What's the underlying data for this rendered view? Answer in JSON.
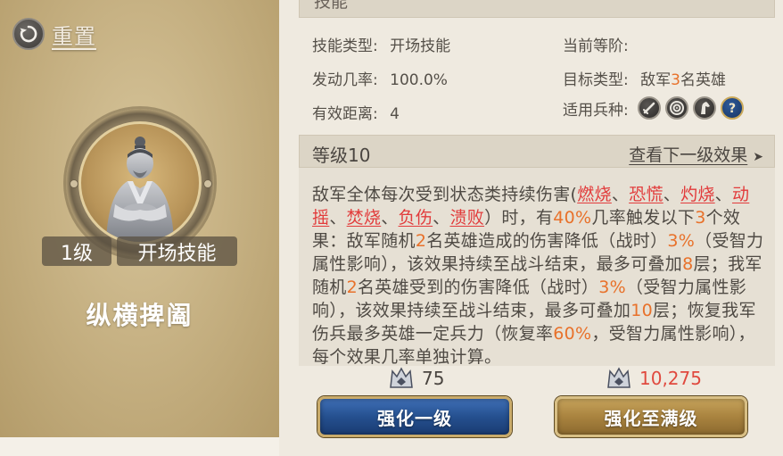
{
  "left": {
    "reset_label": "重置",
    "level_badge": "1级",
    "type_badge": "开场技能",
    "skill_name": "纵横捭阖"
  },
  "right": {
    "header_title": "技能",
    "info": {
      "skill_type_label": "技能类型:",
      "skill_type_value": "开场技能",
      "rank_label": "当前等阶:",
      "rank_value": "",
      "trigger_rate_label": "发动几率:",
      "trigger_rate_value": "100.0%",
      "target_type_label": "目标类型:",
      "target_type_prefix": "敌军",
      "target_type_count": "3",
      "target_type_suffix": "名英雄",
      "range_label": "有效距离:",
      "range_value": "4",
      "unit_types_label": "适用兵种:",
      "unit_icons": [
        "sword-icon",
        "target-icon",
        "horse-icon",
        "question-icon"
      ]
    },
    "level_bar": {
      "title": "等级10",
      "next_link": "查看下一级效果",
      "next_arrow": "➤"
    },
    "description": {
      "p1": "敌军全体每次受到状态类持续伤害(",
      "s1": "燃烧",
      "sep1": "、",
      "s2": "恐慌",
      "sep2": "、",
      "s3": "灼烧",
      "sep3": "、",
      "s4": "动摇",
      "sep4": "、",
      "s5": "焚烧",
      "sep5": "、",
      "s6": "负伤",
      "sep6": "、",
      "s7": "溃败",
      "p2": "）时，有",
      "n1": "40%",
      "p3": "几率触发以下",
      "n2": "3",
      "p4": "个效果：敌军随机",
      "n3": "2",
      "p5": "名英雄造成的伤害降低（战时）",
      "n4": "3%",
      "p6": "（受智力属性影响），该效果持续至战斗结束，最多可叠加",
      "n5": "8",
      "p7": "层；我军随机",
      "n6": "2",
      "p8": "名英雄受到的伤害降低（战时）",
      "n7": "3%",
      "p9": "（受智力属性影响），该效果持续至战斗结束，最多可叠加",
      "n8": "10",
      "p10": "层；恢复我军伤兵最多英雄一定兵力（恢复率",
      "n9": "60%",
      "p11": "，受智力属性影响），每个效果几率单独计算。"
    },
    "cost_left": "75",
    "cost_right": "10,275",
    "btn_upgrade": "强化一级",
    "btn_max": "强化至满级"
  },
  "colors": {
    "accent_orange": "#e8712a",
    "status_red": "#e23b3b",
    "cost_red": "#e04a3f",
    "button_blue": "#25508f",
    "button_gold": "#a9833f"
  }
}
